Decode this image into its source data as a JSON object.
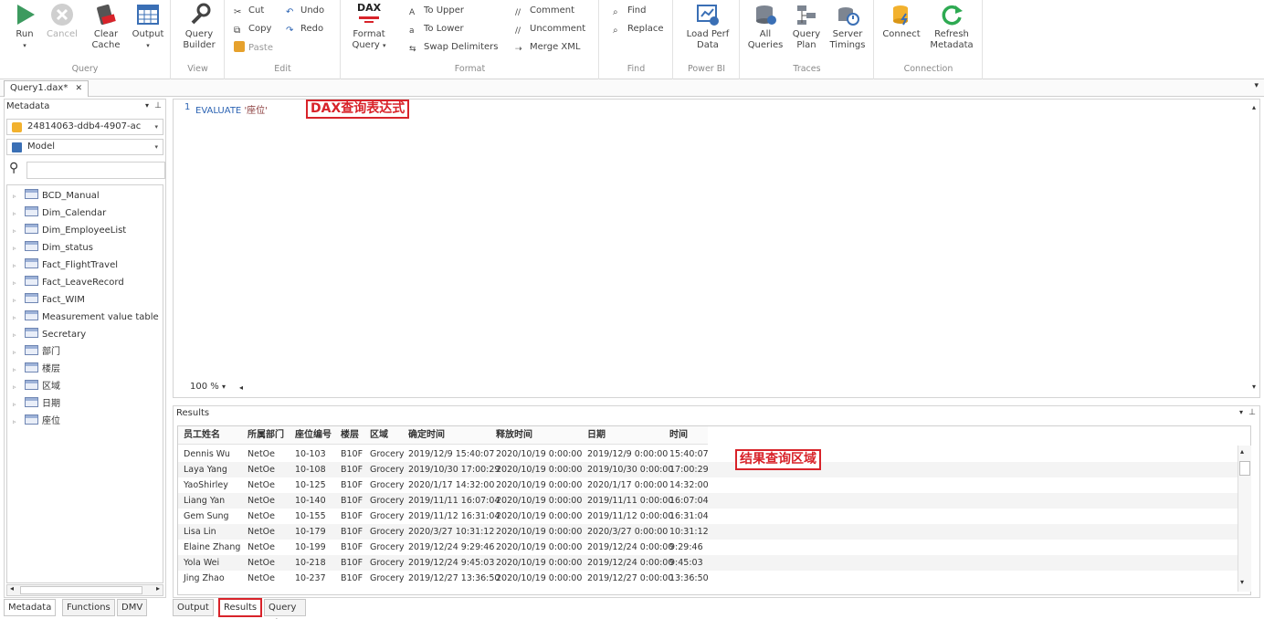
{
  "ribbon": {
    "query_group": {
      "label": "Query",
      "run": "Run",
      "cancel": "Cancel",
      "clear_cache_1": "Clear",
      "clear_cache_2": "Cache",
      "output": "Output"
    },
    "view_group": {
      "label": "View",
      "qb1": "Query",
      "qb2": "Builder"
    },
    "edit_group": {
      "label": "Edit",
      "cut": "Cut",
      "copy": "Copy",
      "paste": "Paste",
      "undo": "Undo",
      "redo": "Redo"
    },
    "format_group": {
      "label": "Format",
      "dax": "DAX",
      "fq1": "Format",
      "fq2": "Query",
      "to_upper": "To Upper",
      "to_lower": "To Lower",
      "swap": "Swap Delimiters",
      "comment": "Comment",
      "uncomment": "Uncomment",
      "merge_xml": "Merge XML"
    },
    "find_group": {
      "label": "Find",
      "find": "Find",
      "replace": "Replace"
    },
    "powerbi_group": {
      "label": "Power BI",
      "lp1": "Load Perf",
      "lp2": "Data"
    },
    "traces_group": {
      "label": "Traces",
      "aq1": "All",
      "aq2": "Queries",
      "qp1": "Query",
      "qp2": "Plan",
      "st1": "Server",
      "st2": "Timings"
    },
    "connection_group": {
      "label": "Connection",
      "connect": "Connect",
      "rm1": "Refresh",
      "rm2": "Metadata"
    }
  },
  "doc_tab": {
    "label": "Query1.dax*",
    "close": "✕"
  },
  "metadata_panel": {
    "title": "Metadata",
    "database": "24814063-ddb4-4907-ac",
    "model": "Model",
    "search_placeholder": "",
    "tables": [
      "BCD_Manual",
      "Dim_Calendar",
      "Dim_EmployeeList",
      "Dim_status",
      "Fact_FlightTravel",
      "Fact_LeaveRecord",
      "Fact_WIM",
      "Measurement value table",
      "Secretary",
      "部门",
      "楼层",
      "区域",
      "日期",
      "座位"
    ]
  },
  "left_tabs": [
    "Metadata",
    "Functions",
    "DMV"
  ],
  "editor": {
    "line_no": "1",
    "keyword": "EVALUATE",
    "argument": "'座位'",
    "annotation": "DAX查询表达式",
    "zoom": "100 %"
  },
  "results": {
    "title": "Results",
    "annotation": "结果查询区域",
    "columns": [
      "员工姓名",
      "所属部门",
      "座位编号",
      "楼层",
      "区域",
      "确定时间",
      "释放时间",
      "日期",
      "时间"
    ],
    "rows": [
      [
        "Dennis Wu",
        "NetOe",
        "10-103",
        "B10F",
        "Grocery",
        "2019/12/9 15:40:07",
        "2020/10/19 0:00:00",
        "2019/12/9 0:00:00",
        "15:40:07"
      ],
      [
        "Laya Yang",
        "NetOe",
        "10-108",
        "B10F",
        "Grocery",
        "2019/10/30 17:00:29",
        "2020/10/19 0:00:00",
        "2019/10/30 0:00:00",
        "17:00:29"
      ],
      [
        "YaoShirley",
        "NetOe",
        "10-125",
        "B10F",
        "Grocery",
        "2020/1/17 14:32:00",
        "2020/10/19 0:00:00",
        "2020/1/17 0:00:00",
        "14:32:00"
      ],
      [
        "Liang Yan",
        "NetOe",
        "10-140",
        "B10F",
        "Grocery",
        "2019/11/11 16:07:04",
        "2020/10/19 0:00:00",
        "2019/11/11 0:00:00",
        "16:07:04"
      ],
      [
        "Gem Sung",
        "NetOe",
        "10-155",
        "B10F",
        "Grocery",
        "2019/11/12 16:31:04",
        "2020/10/19 0:00:00",
        "2019/11/12 0:00:00",
        "16:31:04"
      ],
      [
        "Lisa Lin",
        "NetOe",
        "10-179",
        "B10F",
        "Grocery",
        "2020/3/27 10:31:12",
        "2020/10/19 0:00:00",
        "2020/3/27 0:00:00",
        "10:31:12"
      ],
      [
        "Elaine Zhang",
        "NetOe",
        "10-199",
        "B10F",
        "Grocery",
        "2019/12/24 9:29:46",
        "2020/10/19 0:00:00",
        "2019/12/24 0:00:00",
        "9:29:46"
      ],
      [
        "Yola Wei",
        "NetOe",
        "10-218",
        "B10F",
        "Grocery",
        "2019/12/24 9:45:03",
        "2020/10/19 0:00:00",
        "2019/12/24 0:00:00",
        "9:45:03"
      ],
      [
        "Jing Zhao",
        "NetOe",
        "10-237",
        "B10F",
        "Grocery",
        "2019/12/27 13:36:50",
        "2020/10/19 0:00:00",
        "2019/12/27 0:00:00",
        "13:36:50"
      ]
    ]
  },
  "mid_tabs": [
    "Output",
    "Results",
    "Query History"
  ],
  "colors": {
    "accent_red": "#d8232a",
    "run_green": "#3c9a5f",
    "refresh_green": "#2eaa52"
  }
}
